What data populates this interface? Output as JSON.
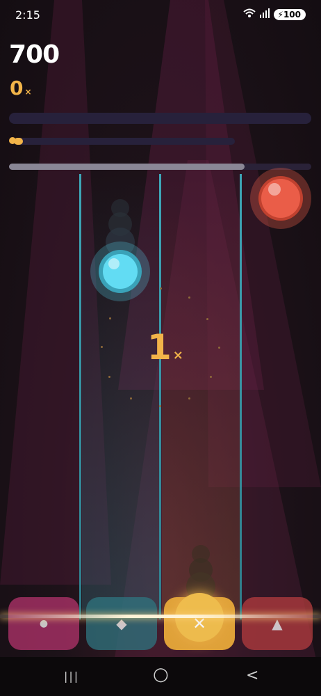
{
  "status_bar": {
    "time": "2:15",
    "battery": "100",
    "wifi_icon": "wifi-icon",
    "signal_icon": "signal-icon"
  },
  "hud": {
    "score": "700",
    "combo": "0",
    "combo_suffix": "×",
    "progress_1": 0,
    "progress_2": 0.04,
    "progress_3": 0.78
  },
  "playfield": {
    "multiplier": "1",
    "multiplier_suffix": "×"
  },
  "pads": [
    {
      "name": "circle",
      "symbol": "●",
      "color": "#b3336c"
    },
    {
      "name": "diamond",
      "symbol": "◆",
      "color": "#2f7580"
    },
    {
      "name": "cross",
      "symbol": "✕",
      "color": "#e8a93a"
    },
    {
      "name": "triangle",
      "symbol": "▲",
      "color": "#b43c3f"
    }
  ],
  "notes": [
    {
      "lane": "diamond",
      "color": "#58d6ee"
    },
    {
      "lane": "triangle",
      "color": "#e35b48"
    }
  ],
  "nav": {
    "recents_icon": "|||",
    "home_icon": "○",
    "back_icon": "<"
  }
}
